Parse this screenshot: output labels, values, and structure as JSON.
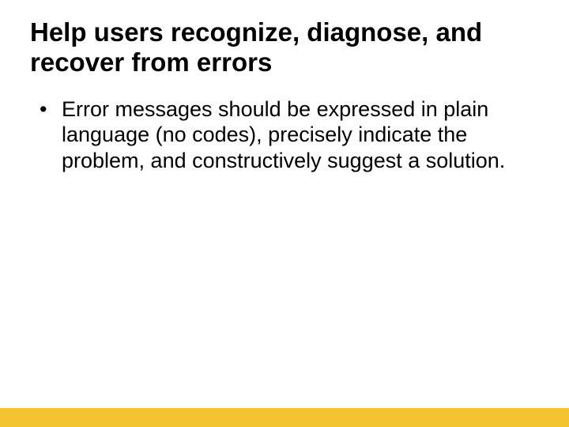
{
  "slide": {
    "title": "Help users recognize, diagnose, and recover from errors",
    "bullets": [
      "Error messages should be expressed in plain language (no codes), precisely indicate the problem, and constructively suggest a solution."
    ]
  }
}
